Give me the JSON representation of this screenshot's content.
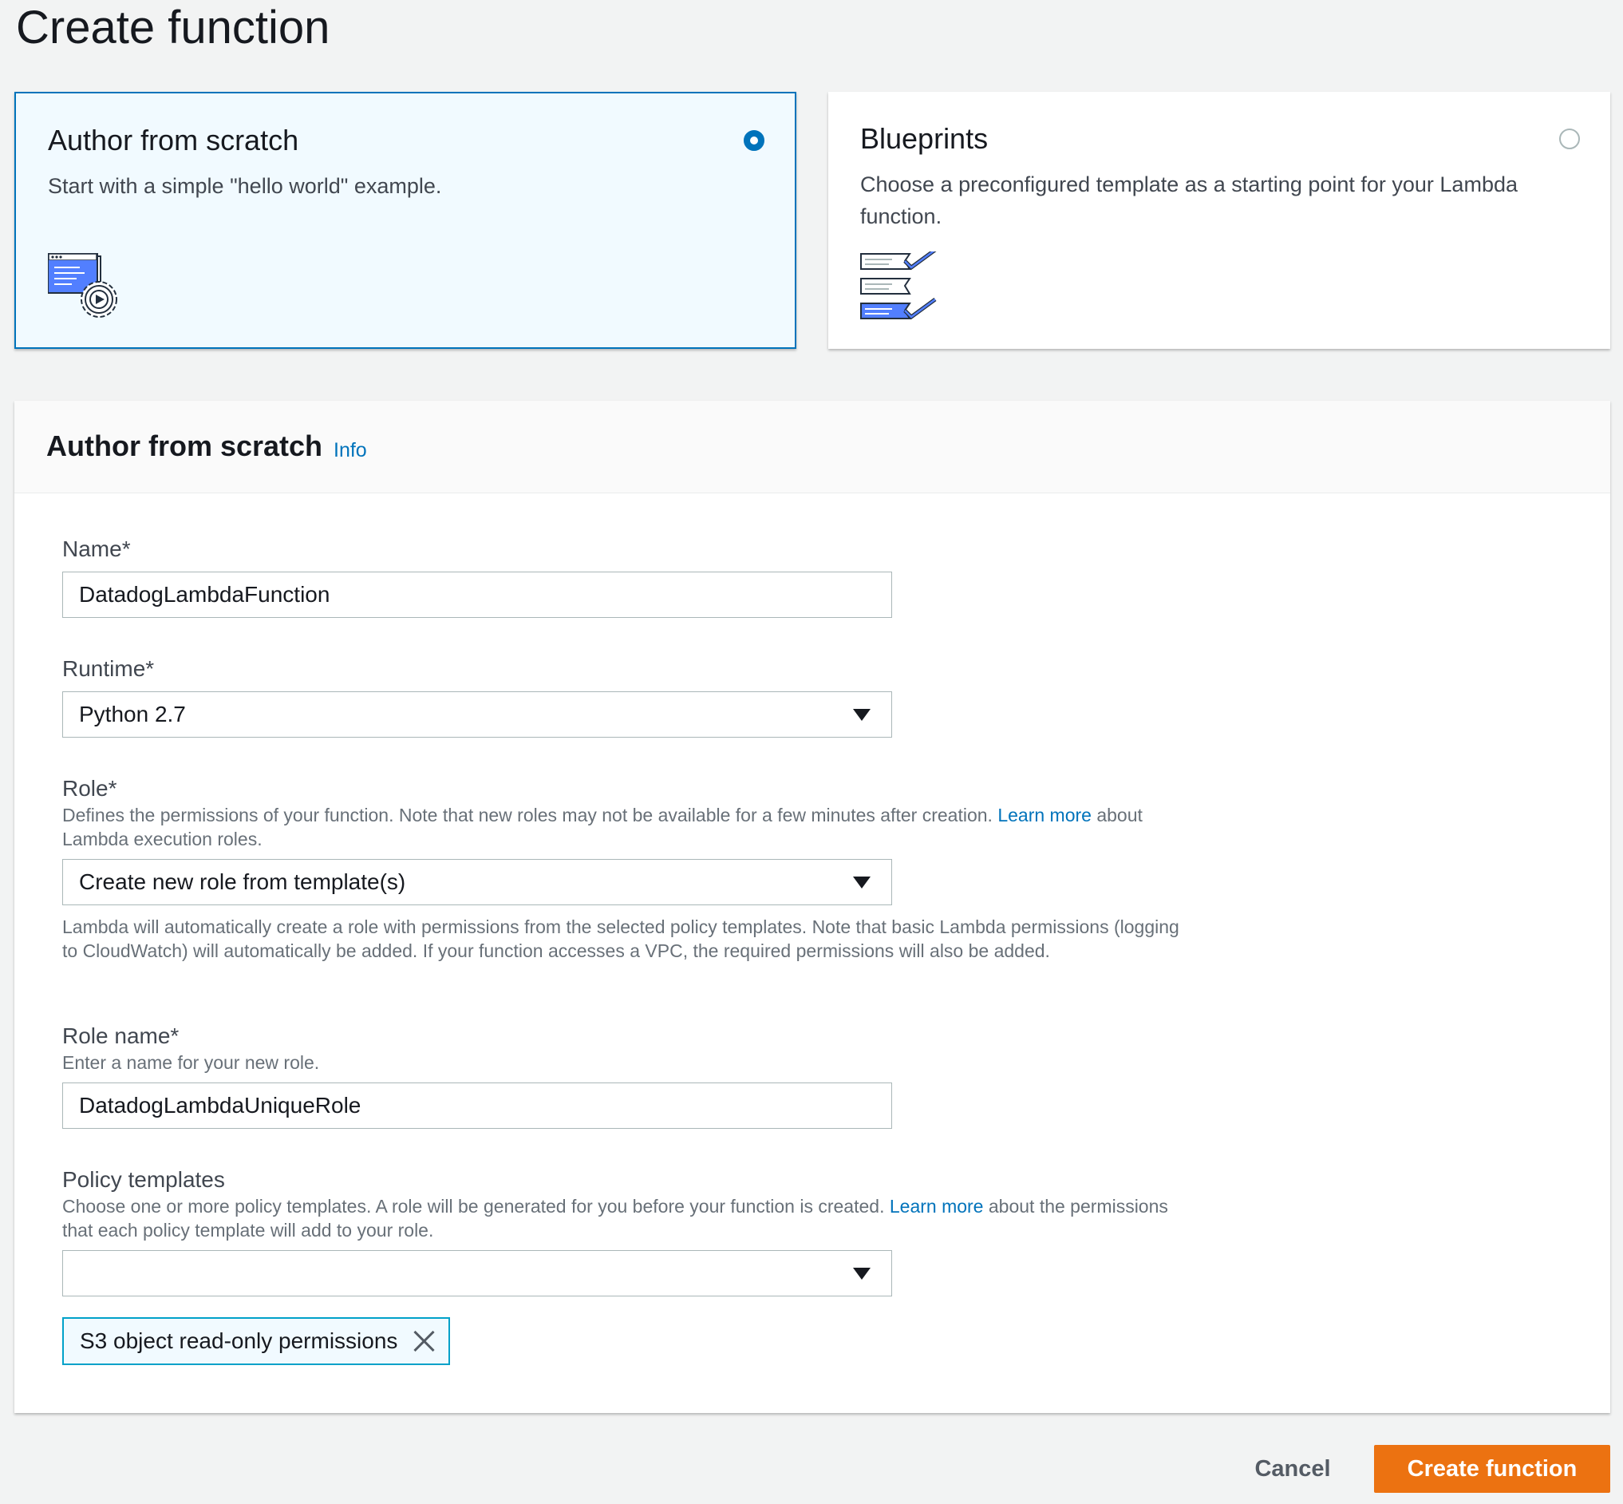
{
  "page": {
    "title": "Create function"
  },
  "options": {
    "scratch": {
      "title": "Author from scratch",
      "description": "Start with a simple \"hello world\" example.",
      "icon": "window-gear-icon",
      "selected": true
    },
    "blueprints": {
      "title": "Blueprints",
      "description": "Choose a preconfigured template as a starting point for your Lambda function.",
      "icon": "checklist-icon",
      "selected": false
    }
  },
  "form": {
    "title": "Author from scratch",
    "info_label": "Info",
    "name": {
      "label": "Name*",
      "value": "DatadogLambdaFunction"
    },
    "runtime": {
      "label": "Runtime*",
      "value": "Python 2.7"
    },
    "role": {
      "label": "Role*",
      "description_before": "Defines the permissions of your function. Note that new roles may not be available for a few minutes after creation. ",
      "description_link": "Learn more",
      "description_after": " about Lambda execution roles.",
      "value": "Create new role from template(s)",
      "help": "Lambda will automatically create a role with permissions from the selected policy templates. Note that basic Lambda permissions (logging to CloudWatch) will automatically be added. If your function accesses a VPC, the required permissions will also be added."
    },
    "role_name": {
      "label": "Role name*",
      "description": "Enter a name for your new role.",
      "value": "DatadogLambdaUniqueRole"
    },
    "policy_templates": {
      "label": "Policy templates",
      "description_before": "Choose one or more policy templates. A role will be generated for you before your function is created. ",
      "description_link": "Learn more",
      "description_after": " about the permissions that each policy template will add to your role.",
      "value": "",
      "selected_tags": [
        "S3 object read-only permissions"
      ]
    }
  },
  "footer": {
    "cancel_label": "Cancel",
    "create_label": "Create function"
  },
  "colors": {
    "accent": "#0073bb",
    "primary_button": "#ec7211",
    "tag_border": "#00a1c9"
  }
}
